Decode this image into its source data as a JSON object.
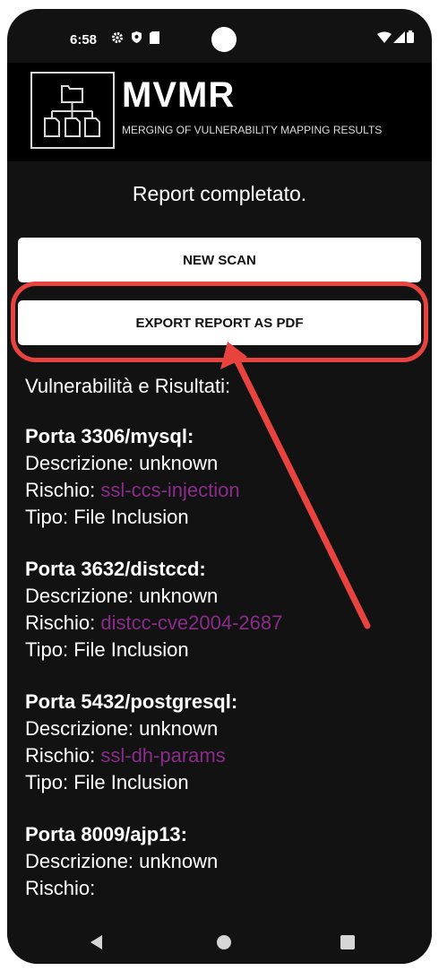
{
  "status_bar": {
    "time": "6:58",
    "left_icons": [
      "settings-gear-icon",
      "shield-icon",
      "sim-card-icon"
    ],
    "right_icons": [
      "wifi-icon",
      "signal-icon",
      "battery-icon"
    ]
  },
  "app": {
    "title": "MVMR",
    "subtitle": "MERGING OF VULNERABILITY MAPPING RESULTS",
    "logo_icon": "folder-hierarchy-icon"
  },
  "status_message": "Report completato.",
  "buttons": {
    "new_scan": "NEW SCAN",
    "export_pdf": "EXPORT REPORT AS PDF"
  },
  "annotation": {
    "highlight_color": "#e8433f"
  },
  "results": {
    "heading": "Vulnerabilità e Risultati:",
    "entries": [
      {
        "port": "Porta 3306/mysql:",
        "description": "Descrizione: unknown",
        "risk_label": "Rischio: ",
        "risk_value": "ssl-ccs-injection",
        "type": "Tipo: File Inclusion"
      },
      {
        "port": "Porta 3632/distccd:",
        "description": "Descrizione: unknown",
        "risk_label": "Rischio: ",
        "risk_value": "distcc-cve2004-2687",
        "type": "Tipo: File Inclusion"
      },
      {
        "port": "Porta 5432/postgresql:",
        "description": "Descrizione: unknown",
        "risk_label": "Rischio: ",
        "risk_value": "ssl-dh-params",
        "type": "Tipo: File Inclusion"
      },
      {
        "port": "Porta 8009/ajp13:",
        "description": "Descrizione: unknown",
        "risk_label": "Rischio: ",
        "risk_value": "",
        "type": ""
      }
    ]
  },
  "nav_bar": {
    "icons": [
      "back-icon",
      "home-icon",
      "recents-icon"
    ]
  },
  "colors": {
    "background": "#121212",
    "header": "#000000",
    "button": "#ffffff",
    "risk_link": "#8a2c8a",
    "annotation": "#e8433f"
  }
}
